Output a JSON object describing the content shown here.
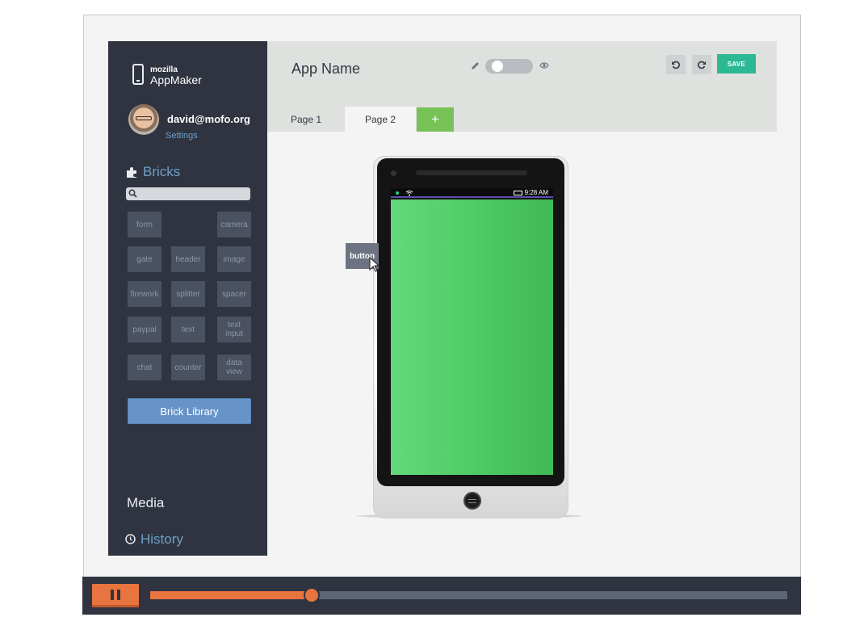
{
  "brand": {
    "small": "mozilla",
    "name": "AppMaker"
  },
  "user": {
    "email": "david@mofo.org",
    "settings_label": "Settings"
  },
  "bricks": {
    "title": "Bricks",
    "search_placeholder": "",
    "items": [
      "form",
      "camera",
      "gate",
      "header",
      "image",
      "firework",
      "splitter",
      "spacer",
      "paypal",
      "text",
      "text input",
      "chat",
      "counter",
      "data view"
    ],
    "library_button": "Brick Library"
  },
  "sidebar_bottom": {
    "media": "Media",
    "history": "History"
  },
  "header": {
    "app_name": "App Name",
    "save_label": "SAVE"
  },
  "tabs": [
    {
      "label": "Page 1"
    },
    {
      "label": "Page 2"
    }
  ],
  "add_tab_label": "+",
  "phone": {
    "time": "9:28 AM"
  },
  "dragging_brick": "button",
  "player": {
    "progress": 0.254
  },
  "colors": {
    "sidebar": "#2f3440",
    "accent_blue": "#6f9fc9",
    "save": "#2bb993",
    "add_tab": "#77c257",
    "screen_green": "#4fcc66",
    "player_orange": "#e8743f"
  }
}
